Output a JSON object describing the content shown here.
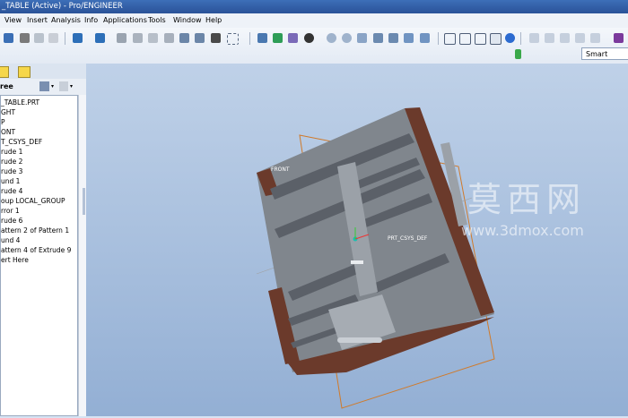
{
  "window": {
    "title": "_TABLE (Active) - Pro/ENGINEER"
  },
  "menu": [
    "View",
    "Insert",
    "Analysis",
    "Info",
    "Applications",
    "Tools",
    "Window",
    "Help"
  ],
  "filter": {
    "value": "Smart"
  },
  "tree": {
    "header": "ree",
    "items": [
      "_TABLE.PRT",
      "GHT",
      "P",
      "ONT",
      "T_CSYS_DEF",
      "rude 1",
      "rude 2",
      "rude 3",
      "und 1",
      "rude 4",
      "oup LOCAL_GROUP",
      "rror 1",
      "rude 6",
      "attern 2 of Pattern 1",
      "und 4",
      "attern 4 of Extrude 9",
      "ert Here"
    ]
  },
  "viewport": {
    "datum_front_label": "FRONT",
    "csys_label": "PRT_CSYS_DEF",
    "watermark_cn": "莫西网",
    "watermark_url": "www.3dmox.com"
  },
  "colors": {
    "wood": "#6b3a2b",
    "panel": "#8e949b",
    "panel_dark": "#5b6068",
    "datum": "#d07a2a",
    "bg_top": "#bfd1e8",
    "bg_bottom": "#93afd4"
  }
}
